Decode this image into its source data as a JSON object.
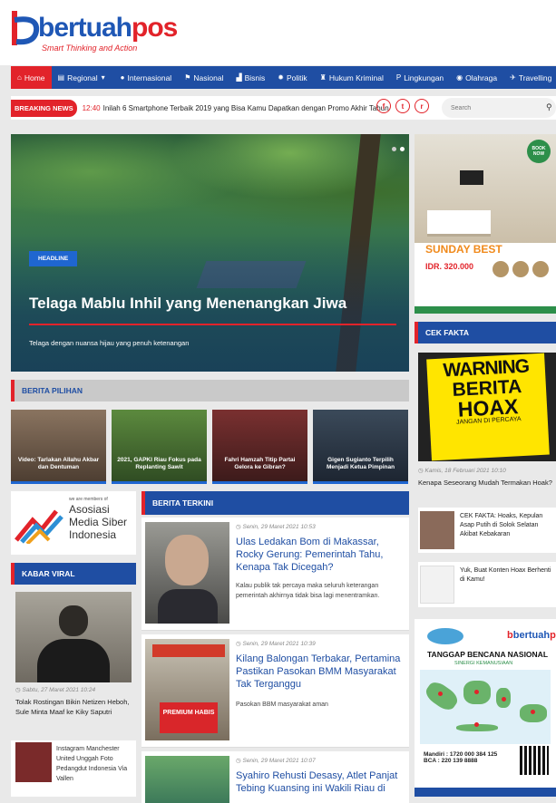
{
  "brand": {
    "name_part1": "bertuah",
    "name_part2": "pos",
    "tagline": "Smart Thinking and Action",
    "primary_color": "#1f57b5",
    "accent_color": "#e2232a"
  },
  "nav": {
    "items": [
      {
        "label": "Home",
        "icon": "home-icon",
        "active": true
      },
      {
        "label": "Regional",
        "icon": "map-icon",
        "dropdown": true
      },
      {
        "label": "Internasional",
        "icon": "globe-icon"
      },
      {
        "label": "Nasional",
        "icon": "flag-icon"
      },
      {
        "label": "Bisnis",
        "icon": "chart-icon"
      },
      {
        "label": "Politik",
        "icon": "gear-icon"
      },
      {
        "label": "Hukum Kriminal",
        "icon": "scale-icon"
      },
      {
        "label": "Lingkungan",
        "icon": "leaf-icon"
      },
      {
        "label": "Olahraga",
        "icon": "ball-icon"
      },
      {
        "label": "Travelling",
        "icon": "plane-icon"
      }
    ]
  },
  "breaking": {
    "label": "BREAKING NEWS",
    "time": "12:40",
    "text": "Inilah 6 Smartphone Terbaik 2019 yang Bisa Kamu Dapatkan dengan Promo Akhir Tahun"
  },
  "social": [
    "f",
    "t",
    "r"
  ],
  "search": {
    "placeholder": "Search"
  },
  "hero": {
    "badge": "HEADLINE",
    "title": "Telaga Mablu Inhil yang Menenangkan Jiwa",
    "subtitle": "Telaga dengan nuansa hijau yang penuh ketenangan"
  },
  "ad_top": {
    "stamp": "BOOK NOW",
    "headline": "SUNDAY BEST",
    "price": "IDR. 320.000"
  },
  "cek_fakta": {
    "heading": "CEK FAKTA",
    "poster": {
      "line1": "WARNING",
      "line2": "BERITA",
      "line3": "HOAX",
      "line4": "JANGAN DI PERCAYA"
    },
    "main": {
      "date": "Kamis, 18 Februari 2021 10:10",
      "title": "Kenapa Seseorang Mudah Termakan Hoak?"
    },
    "items": [
      {
        "title": "CEK FAKTA: Hoaks, Kepulan Asap Putih di Solok Selatan Akibat Kebakaran"
      },
      {
        "title": "Yuk, Buat Konten Hoax Berhenti di Kamu!"
      }
    ]
  },
  "ad_bencana": {
    "title": "TANGGAP BENCANA NASIONAL",
    "subtitle": "SINERGI KEMANUSIAAN",
    "mandiri": "Mandiri : 1720 000 384 125",
    "bca": "BCA : 220 139 8888"
  },
  "pilihan": {
    "heading": "BERITA PILIHAN",
    "items": [
      {
        "caption": "Video: Tarlakan Allahu Akbar dan Dentuman"
      },
      {
        "caption": "2021, GAPKI Riau Fokus pada Replanting Sawit"
      },
      {
        "caption": "Fahri Hamzah Titip Partai Gelora ke Gibran?"
      },
      {
        "caption": "Gigen Sugianto Terpilih Menjadi Ketua Pimpinan"
      }
    ]
  },
  "asosiasi": {
    "small": "we are members of",
    "line1": "Asosiasi",
    "line2": "Media Siber",
    "line3": "Indonesia"
  },
  "kabar_viral": {
    "heading": "KABAR VIRAL",
    "main": {
      "date": "Sabtu, 27 Maret 2021 10:24",
      "title": "Tolak Rostingan Bikin Netizen Heboh, Sule Minta Maaf ke Kiky Saputri"
    },
    "items": [
      {
        "title": "Instagram Manchester United Unggah Foto Pedangdut Indonesia Via Vallen"
      }
    ]
  },
  "terkini": {
    "heading": "BERITA TERKINI",
    "items": [
      {
        "date": "Senin, 29 Maret 2021 10:53",
        "title": "Ulas Ledakan Bom di Makassar, Rocky Gerung: Pemerintah Tahu, Kenapa Tak Dicegah?",
        "desc": "Kalau publik tak percaya maka seluruh keterangan pemerintah akhirnya tidak bisa lagi menentramkan."
      },
      {
        "date": "Senin, 29 Maret 2021 10:39",
        "title": "Kilang Balongan Terbakar, Pertamina Pastikan Pasokan BMM Masyarakat Tak Terganggu",
        "desc": "Pasokan BBM masyarakat aman",
        "thumb_sign": "PREMIUM HABIS"
      },
      {
        "date": "Senin, 29 Maret 2021 10:07",
        "title": "Syahiro Rehusti Desasy, Atlet Panjat Tebing Kuansing ini Wakili Riau di"
      }
    ]
  }
}
